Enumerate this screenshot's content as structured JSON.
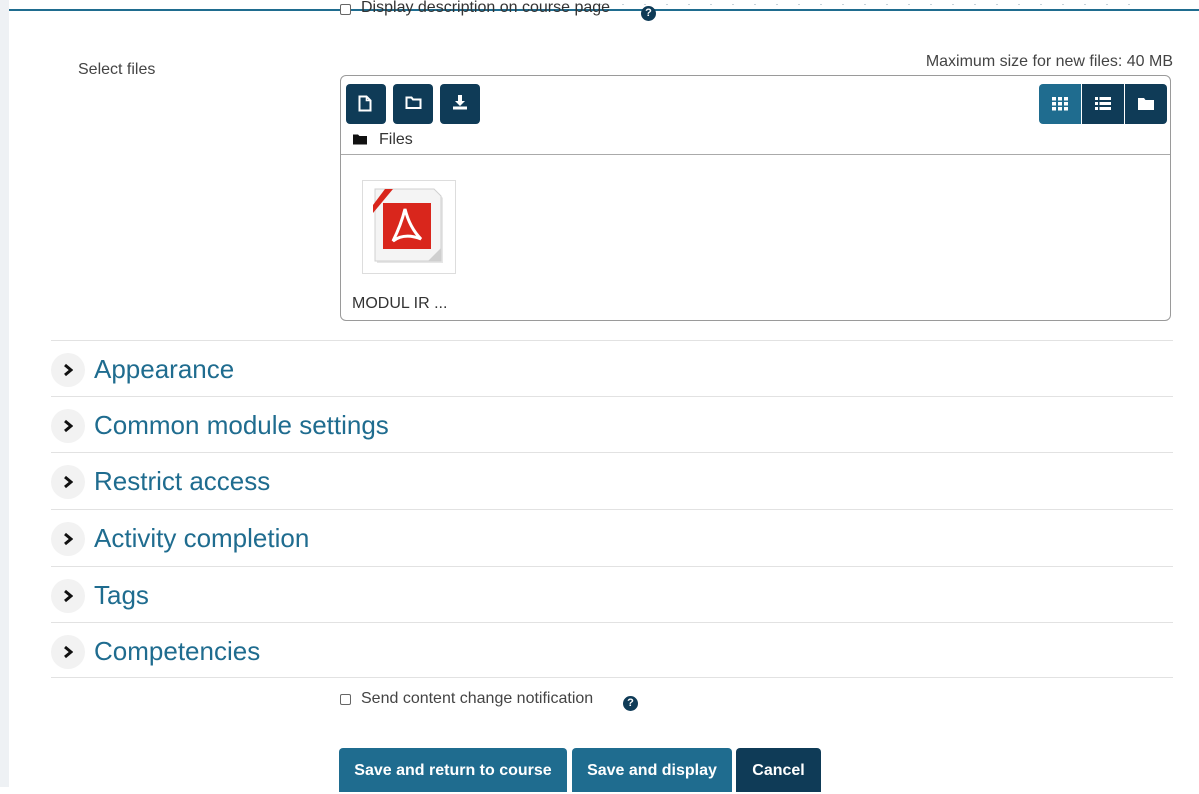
{
  "colors": {
    "accent": "#1f6c8f",
    "dark": "#0f3b57",
    "pdf_red": "#d9261c"
  },
  "display_description": {
    "label": "Display description on course page",
    "checked": false,
    "help_icon": "question-circle-icon"
  },
  "select_files": {
    "label": "Select files",
    "max_size": "Maximum size for new files: 40 MB",
    "toolbar": {
      "buttons": [
        {
          "name": "add-file",
          "icon": "file-icon"
        },
        {
          "name": "create-folder",
          "icon": "folder-icon"
        },
        {
          "name": "download",
          "icon": "download-icon"
        }
      ],
      "views": [
        {
          "name": "icons",
          "icon": "grid-icon",
          "active": true
        },
        {
          "name": "list",
          "icon": "list-icon",
          "active": false
        },
        {
          "name": "tree",
          "icon": "folder-icon",
          "active": false
        }
      ]
    },
    "path": "Files",
    "files": [
      {
        "name": "MODUL IR ...",
        "type": "pdf",
        "icon": "pdf-icon"
      }
    ]
  },
  "sections": [
    {
      "title": "Appearance"
    },
    {
      "title": "Common module settings"
    },
    {
      "title": "Restrict access"
    },
    {
      "title": "Activity completion"
    },
    {
      "title": "Tags"
    },
    {
      "title": "Competencies"
    }
  ],
  "notification": {
    "label": "Send content change notification",
    "checked": false,
    "help_icon": "question-circle-icon"
  },
  "buttons": {
    "save_return": "Save and return to course",
    "save_display": "Save and display",
    "cancel": "Cancel"
  }
}
